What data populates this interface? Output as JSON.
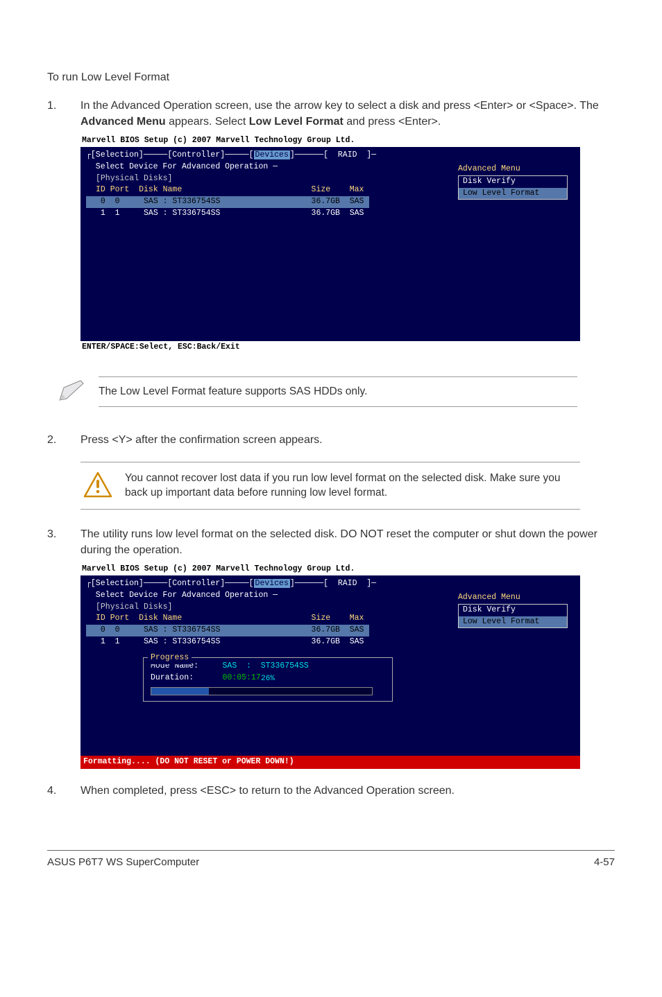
{
  "heading": "To run Low Level Format",
  "steps": {
    "s1_a": "In the Advanced Operation screen, use the arrow key to select a disk and press <Enter> or <Space>. The ",
    "s1_b": "Advanced Menu",
    "s1_c": " appears. Select ",
    "s1_d": "Low Level Format",
    "s1_e": " and press <Enter>.",
    "s2": "Press <Y> after the confirmation screen appears.",
    "s3": "The utility runs low level format on the selected disk. DO NOT reset the computer or shut down the power during the operation.",
    "s4": "When completed, press <ESC> to return to the Advanced Operation screen."
  },
  "bios": {
    "title": "Marvell BIOS Setup (c) 2007 Marvell Technology Group Ltd.",
    "tabs": "┌[Selection]─────[Controller]─────[ Devices ]──────[  RAID  ]─",
    "tab_hl": "Devices",
    "sub": "  Select Device For Advanced Operation ─",
    "section": "[Physical Disks]",
    "colhead": "ID Port  Disk Name                           Size    Max",
    "row0": " 0  0     SAS : ST336754SS                   36.7GB  SAS ",
    "row1": " 1  1     SAS : ST336754SS                   36.7GB  SAS ",
    "foot1": "ENTER/SPACE:Select, ESC:Back/Exit",
    "foot2": "Formatting.... (DO NOT RESET or POWER DOWN!)",
    "adv_title": "Advanced Menu",
    "adv_item1": "Disk Verify",
    "adv_item2": "Low Level Format",
    "prog_title": "Progress",
    "prog_mode_lbl": "Mode Name:",
    "prog_mode_val": "SAS  :  ST336754SS",
    "prog_dur_lbl": "Duration:",
    "prog_dur_val": "00:05:17",
    "prog_pct": "26%"
  },
  "notes": {
    "n1": "The Low Level Format feature supports SAS HDDs only.",
    "n2": "You cannot recover lost data if you run low level format on the selected disk. Make sure you back up important data before running low level format."
  },
  "footer": {
    "left": "ASUS P6T7 WS SuperComputer",
    "right": "4-57"
  }
}
